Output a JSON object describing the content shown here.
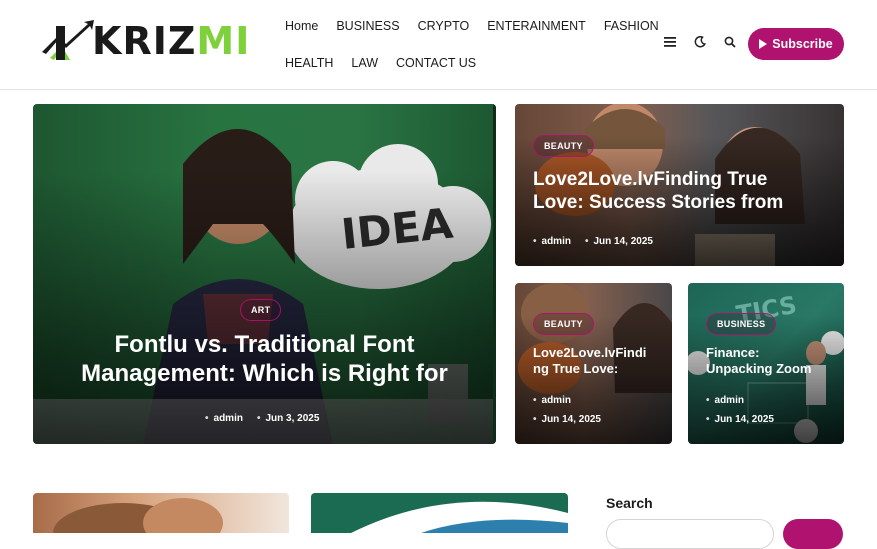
{
  "brand": {
    "logo_text_main": "KRIZ",
    "logo_text_accent": "MI",
    "accent_color": "#7ed13a"
  },
  "nav": {
    "row1": [
      "Home",
      "BUSINESS",
      "CRYPTO",
      "ENTERAINMENT",
      "FASHION"
    ],
    "row2": [
      "HEALTH",
      "LAW",
      "CONTACT US"
    ]
  },
  "header_icons": [
    "menu-icon",
    "moon-icon",
    "search-icon"
  ],
  "subscribe": {
    "label": "Subscribe",
    "color": "#b0126f"
  },
  "featured": [
    {
      "category": "ART",
      "title_line1": "Fontlu vs. Traditional Font",
      "title_line2": "Management: Which is Right for",
      "author": "admin",
      "date": "Jun 3, 2025"
    },
    {
      "category": "BEAUTY",
      "title_line1": "Love2Love.lvFinding True",
      "title_line2": "Love: Success Stories from",
      "author": "admin",
      "date": "Jun 14, 2025"
    },
    {
      "category": "BEAUTY",
      "title_line1": "Love2Love.lvFindi",
      "title_line2": "ng True Love:",
      "author": "admin",
      "date": "Jun 14, 2025"
    },
    {
      "category": "BUSINESS",
      "title_line1": "Finance:",
      "title_line2": "Unpacking Zoom",
      "author": "admin",
      "date": "Jun 14, 2025"
    }
  ],
  "sidebar": {
    "search_title": "Search"
  }
}
